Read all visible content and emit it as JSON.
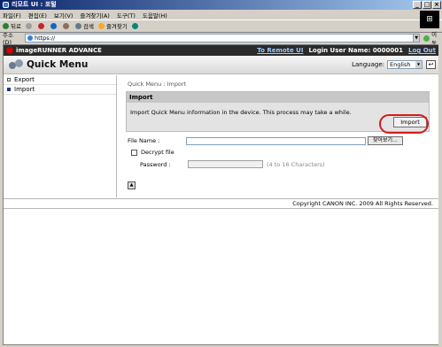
{
  "window": {
    "title": "리모트 UI : 포털"
  },
  "menubar": {
    "items": [
      "파일(F)",
      "편집(E)",
      "보기(V)",
      "즐겨찾기(A)",
      "도구(T)",
      "도움말(H)"
    ]
  },
  "toolbar": {
    "back": "뒤로",
    "search": "검색",
    "favorites": "즐겨찾기"
  },
  "address": {
    "label": "주소(D)",
    "url": "https://",
    "go": "이동"
  },
  "app": {
    "product": "imageRUNNER ADVANCE",
    "remote_link": "To Remote UI",
    "login_label": "Login User Name: 0000001",
    "logout": "Log Out",
    "page_title": "Quick Menu",
    "language_label": "Language:",
    "language_value": "English"
  },
  "sidebar": {
    "items": [
      {
        "label": "Export"
      },
      {
        "label": "Import"
      }
    ]
  },
  "breadcrumb": "Quick Menu : Import",
  "import_panel": {
    "header": "Import",
    "description": "Import Quick Menu information in the device. This process may take a while.",
    "button": "Import"
  },
  "form": {
    "file_label": "File Name :",
    "browse_button": "찾아보기...",
    "decrypt_label": "Decrypt file",
    "password_label": "Password :",
    "password_hint": "(4 to 16 Characters)"
  },
  "footer": {
    "copyright": "Copyright CANON INC. 2009 All Rights Reserved."
  }
}
